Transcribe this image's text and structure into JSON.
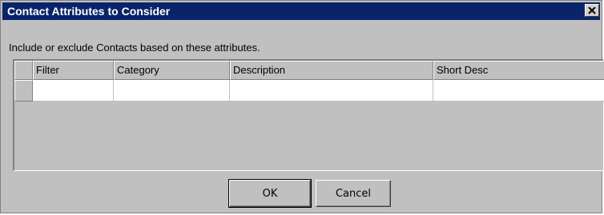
{
  "dialog": {
    "title": "Contact Attributes to Consider",
    "instruction": "Include or exclude Contacts based on these attributes."
  },
  "grid": {
    "columns": [
      "Filter",
      "Category",
      "Description",
      "Short Desc"
    ],
    "rows": [
      [
        "",
        "",
        "",
        ""
      ]
    ]
  },
  "buttons": {
    "ok": "OK",
    "cancel": "Cancel"
  },
  "icons": {
    "close": "close-icon"
  },
  "colors": {
    "titlebar": "#0a246a",
    "face": "#c0c0c0",
    "cell": "#ffffff"
  }
}
